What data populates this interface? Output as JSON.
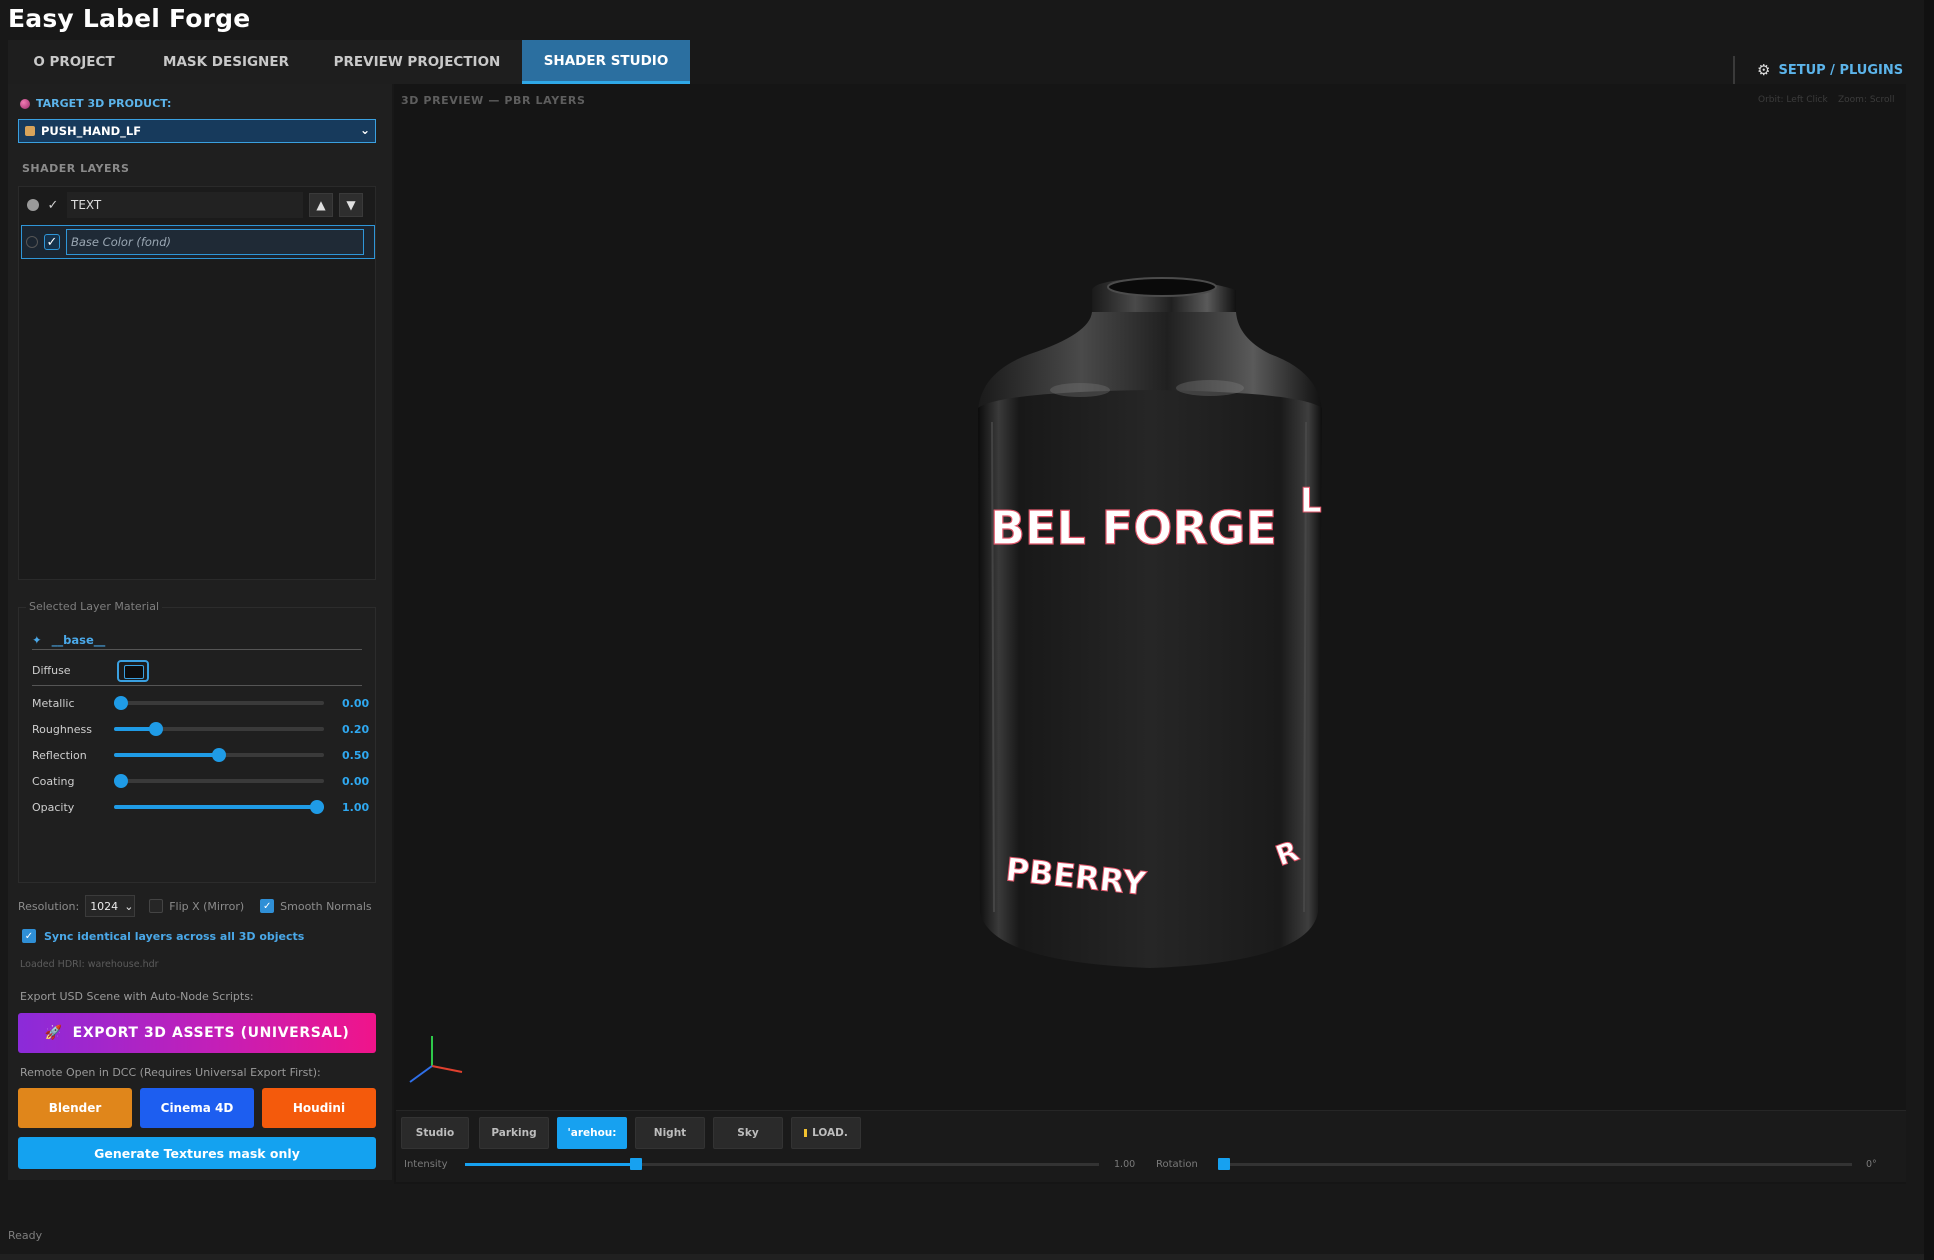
{
  "app": {
    "title": "Easy Label Forge"
  },
  "tabs": [
    {
      "label": "O PROJECT"
    },
    {
      "label": "MASK DESIGNER"
    },
    {
      "label": "PREVIEW PROJECTION"
    },
    {
      "label": "SHADER STUDIO",
      "active": true
    }
  ],
  "header": {
    "setup_label": "SETUP / PLUGINS",
    "setup_icon": "gear-icon"
  },
  "left": {
    "target_label": "TARGET 3D PRODUCT:",
    "target_value": "PUSH_HAND_LF",
    "shader_layers_label": "SHADER LAYERS",
    "layers": [
      {
        "name": "TEXT",
        "visible": true,
        "checked": true,
        "placeholder": false
      },
      {
        "name": "Base Color (fond)",
        "visible": false,
        "checked": true,
        "placeholder": true
      }
    ],
    "material": {
      "group_title": "Selected Layer Material",
      "name": "__base__",
      "diffuse_label": "Diffuse",
      "diffuse_color": "#0d0d0d",
      "sliders": [
        {
          "label": "Metallic",
          "value": 0.0,
          "display": "0.00"
        },
        {
          "label": "Roughness",
          "value": 0.2,
          "display": "0.20"
        },
        {
          "label": "Reflection",
          "value": 0.5,
          "display": "0.50"
        },
        {
          "label": "Coating",
          "value": 0.0,
          "display": "0.00"
        },
        {
          "label": "Opacity",
          "value": 1.0,
          "display": "1.00"
        }
      ]
    },
    "resolution_label": "Resolution:",
    "resolution_value": "1024",
    "flip_x_label": "Flip X (Mirror)",
    "flip_x_checked": false,
    "smooth_normals_label": "Smooth Normals",
    "smooth_normals_checked": true,
    "sync_label": "Sync identical layers across all 3D objects",
    "sync_checked": true,
    "hdri_loaded": "Loaded HDRI: warehouse.hdr",
    "export_label": "Export USD Scene with Auto-Node Scripts:",
    "export_button": "EXPORT 3D ASSETS (UNIVERSAL)",
    "remote_label": "Remote Open in DCC (Requires Universal Export First):",
    "dcc_buttons": {
      "blender": "Blender",
      "cinema": "Cinema 4D",
      "houdini": "Houdini"
    },
    "generate_button": "Generate Textures mask only"
  },
  "viewport": {
    "title": "3D PREVIEW — PBR LAYERS",
    "hint_orbit": "Orbit: Left Click",
    "hint_zoom": "Zoom: Scroll",
    "label_text_top": "BEL FORGE",
    "label_text_top_side": "L",
    "label_text_bottom": "PBERRY",
    "label_text_bottom_side": "R",
    "environments": [
      {
        "label": "Studio",
        "active": false
      },
      {
        "label": "Parking",
        "active": false
      },
      {
        "label": "'arehou:",
        "active": true
      },
      {
        "label": "Night",
        "active": false
      },
      {
        "label": "Sky",
        "active": false
      },
      {
        "label": "LOAD.",
        "active": false
      }
    ],
    "intensity_label": "Intensity",
    "intensity_value": "1.00",
    "intensity_fraction": 0.27,
    "rotation_label": "Rotation",
    "rotation_value": "0°"
  },
  "status": {
    "text": "Ready"
  }
}
